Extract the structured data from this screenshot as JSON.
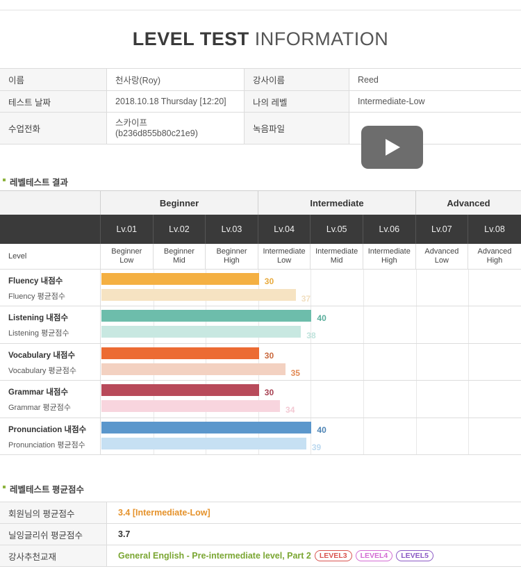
{
  "title": {
    "bold": "LEVEL TEST",
    "light": "INFORMATION"
  },
  "info": {
    "rows": [
      {
        "label1": "이름",
        "value1": "천사랑(Roy)",
        "label2": "강사이름",
        "value2": "Reed"
      },
      {
        "label1": "테스트 날짜",
        "value1": "2018.10.18  Thursday [12:20]",
        "label2": "나의 레벨",
        "value2": "Intermediate-Low"
      },
      {
        "label1": "수업전화",
        "value1": "스카이프\n(b236d855b80c21e9)",
        "label2": "녹음파일",
        "value2": ""
      }
    ]
  },
  "results": {
    "section_title": "레벨테스트 결과",
    "groups": [
      "Beginner",
      "Intermediate",
      "Advanced"
    ],
    "levels": [
      "Lv.01",
      "Lv.02",
      "Lv.03",
      "Lv.04",
      "Lv.05",
      "Lv.06",
      "Lv.07",
      "Lv.08"
    ],
    "level_row_label": "Level",
    "level_names": [
      "Beginner\nLow",
      "Beginner\nMid",
      "Beginner\nHigh",
      "Intermediate\nLow",
      "Intermediate\nMid",
      "Intermediate\nHigh",
      "Advanced\nLow",
      "Advanced\nHigh"
    ],
    "skills": [
      {
        "my_label": "Fluency 내점수",
        "avg_label": "Fluency 평균점수",
        "my": 30,
        "avg": 37,
        "color": "#f4b042",
        "avg_color": "#f6e3c2",
        "my_text_color": "#e8a93b",
        "avg_text_color": "#f1dfc0"
      },
      {
        "my_label": "Listening 내점수",
        "avg_label": "Listening 평균점수",
        "my": 40,
        "avg": 38,
        "color": "#6dbdab",
        "avg_color": "#c8e8e1",
        "my_text_color": "#58ad9b",
        "avg_text_color": "#bfe3dc"
      },
      {
        "my_label": "Vocabulary 내점수",
        "avg_label": "Vocabulary 평균점수",
        "my": 30,
        "avg": 35,
        "color": "#ec6b33",
        "avg_color": "#f3d1c1",
        "my_text_color": "#c9683d",
        "avg_text_color": "#e28a55"
      },
      {
        "my_label": "Grammar 내점수",
        "avg_label": "Grammar 평균점수",
        "my": 30,
        "avg": 34,
        "color": "#b84a5a",
        "avg_color": "#f8d5de",
        "my_text_color": "#a74051",
        "avg_text_color": "#f3c9d3"
      },
      {
        "my_label": "Pronunciation 내점수",
        "avg_label": "Pronunciation 평균점수",
        "my": 40,
        "avg": 39,
        "color": "#5b97cc",
        "avg_color": "#c6e0f3",
        "my_text_color": "#4c83b4",
        "avg_text_color": "#bcd9ef"
      }
    ]
  },
  "average": {
    "section_title": "레벨테스트 평균점수",
    "rows": [
      {
        "label": "회원님의 평균점수",
        "value": "3.4 [Intermediate-Low]"
      },
      {
        "label": "닐잉글리쉬 평균점수",
        "value": "3.7"
      },
      {
        "label": "강사추천교재",
        "value": "General English - Pre-intermediate level, Part 2"
      }
    ],
    "tags": [
      {
        "text": "LEVEL3",
        "color": "#d9534f"
      },
      {
        "text": "LEVEL4",
        "color": "#d36bd3"
      },
      {
        "text": "LEVEL5",
        "color": "#8a58c4"
      }
    ]
  },
  "colors": {
    "accent_green": "#8db33e",
    "accent_orange": "#e5922b",
    "header_dark": "#3a3a3a"
  }
}
